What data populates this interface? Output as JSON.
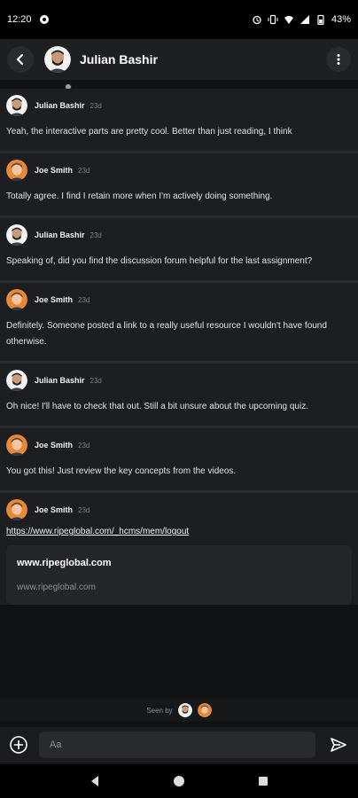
{
  "status_bar": {
    "time": "12:20",
    "battery": "43%",
    "icons": [
      "notification-icon",
      "alarm-icon",
      "vibrate-icon",
      "wifi-icon",
      "signal-icon",
      "battery-icon"
    ]
  },
  "header": {
    "title": "Julian Bashir",
    "back_icon": "chevron-left-icon",
    "menu_icon": "more-vertical-icon"
  },
  "messages": [
    {
      "sender": "Julian Bashir",
      "time": "23d",
      "text": "Yeah, the interactive parts are pretty cool. Better than just reading, I think"
    },
    {
      "sender": "Joe Smith",
      "time": "23d",
      "text": "Totally agree. I find I retain more when I'm actively doing something."
    },
    {
      "sender": "Julian Bashir",
      "time": "23d",
      "text": "Speaking of, did you find the discussion forum helpful for the last assignment?"
    },
    {
      "sender": "Joe Smith",
      "time": "23d",
      "text": "Definitely. Someone posted a link to a really useful resource I wouldn't have found otherwise."
    },
    {
      "sender": "Julian Bashir",
      "time": "23d",
      "text": "Oh nice! I'll have to check that out. Still a bit unsure about the upcoming quiz."
    },
    {
      "sender": "Joe Smith",
      "time": "23d",
      "text": "You got this! Just review the key concepts from the videos."
    }
  ],
  "link_message": {
    "sender": "Joe Smith",
    "time": "23d",
    "url": "https://www.ripeglobal.com/_hcms/mem/logout",
    "preview_title": "www.ripeglobal.com",
    "preview_domain": "www.ripeglobal.com"
  },
  "seen_by": {
    "label": "Seen by"
  },
  "composer": {
    "placeholder": "Aa"
  },
  "colors": {
    "background": "#111214",
    "message_bg": "#1d1e21",
    "header_bg": "#1e1f22",
    "accent": "#ffffff"
  }
}
